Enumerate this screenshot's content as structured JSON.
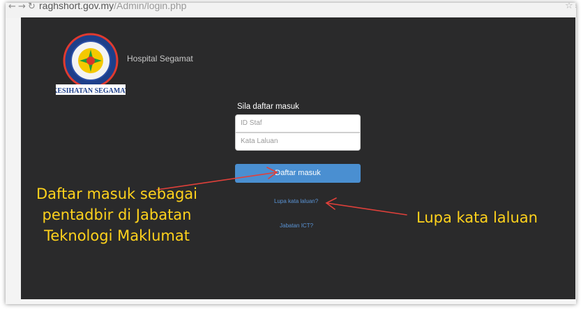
{
  "browser": {
    "url_host": "raghshort.gov.my",
    "url_path": "/Admin/login.php"
  },
  "site": {
    "hospital_name": "Hospital Segamat",
    "logo_text_bottom": "KESIHATAN SEGAMAT"
  },
  "login": {
    "title": "Sila daftar masuk",
    "staff_id_placeholder": "ID Staf",
    "password_placeholder": "Kata Laluan",
    "submit_label": "Daftar masuk",
    "forgot_link": "Lupa kata laluan?",
    "ict_link": "Jabatan ICT?"
  },
  "annotations": {
    "left_line1": "Daftar masuk sebagai",
    "left_line2": "pentadbir di Jabatan",
    "left_line3": "Teknologi Maklumat",
    "right": "Lupa kata laluan",
    "color": "#ffd21c",
    "arrow_color": "#e0403a"
  },
  "colors": {
    "page_bg": "#2a2a2b",
    "button": "#4a8fd1",
    "link": "#5a94d6"
  }
}
